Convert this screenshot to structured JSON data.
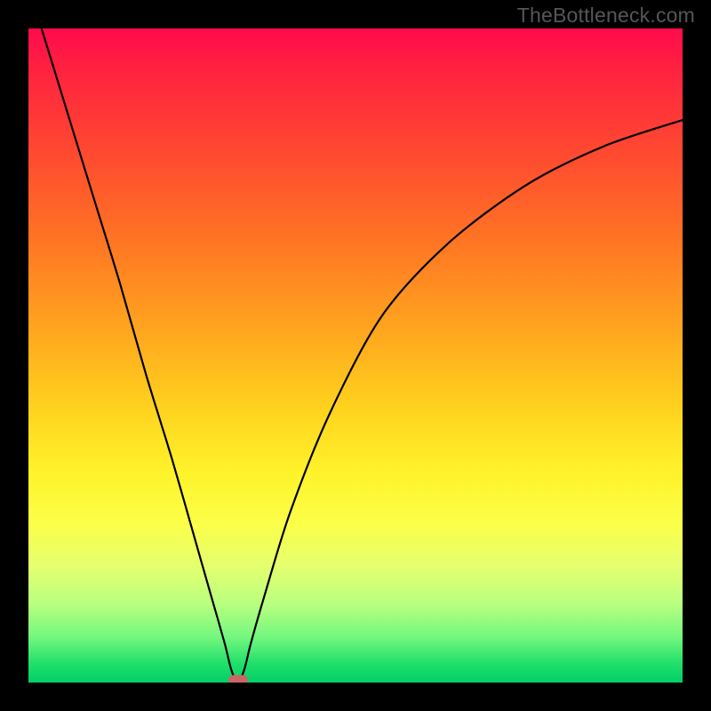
{
  "watermark": "TheBottleneck.com",
  "colors": {
    "frame": "#000000",
    "gradient_top": "#ff0a4c",
    "gradient_bottom": "#00cf68",
    "curve_stroke": "#000000",
    "marker": "#cc6666",
    "watermark": "#565656"
  },
  "chart_data": {
    "type": "line",
    "title": "",
    "xlabel": "",
    "ylabel": "",
    "xlim": [
      0,
      100
    ],
    "ylim": [
      0,
      100
    ],
    "grid": false,
    "legend": false,
    "notes": "V-shaped bottleneck curve over red→green vertical gradient; minimum sits near x≈32 at y≈0; left arm steep, right arm shallower, concave upward.",
    "series": [
      {
        "name": "bottleneck-curve",
        "x": [
          2,
          6,
          10,
          14,
          18,
          22,
          26,
          28,
          30,
          31,
          32,
          33,
          34,
          36,
          40,
          46,
          54,
          64,
          76,
          88,
          100
        ],
        "y": [
          100,
          87,
          74,
          61,
          47,
          34,
          20,
          13,
          6,
          2,
          0,
          2,
          6,
          13,
          26,
          41,
          56,
          67,
          76,
          82,
          86
        ]
      }
    ],
    "vertex": {
      "x": 32,
      "y": 0
    }
  }
}
